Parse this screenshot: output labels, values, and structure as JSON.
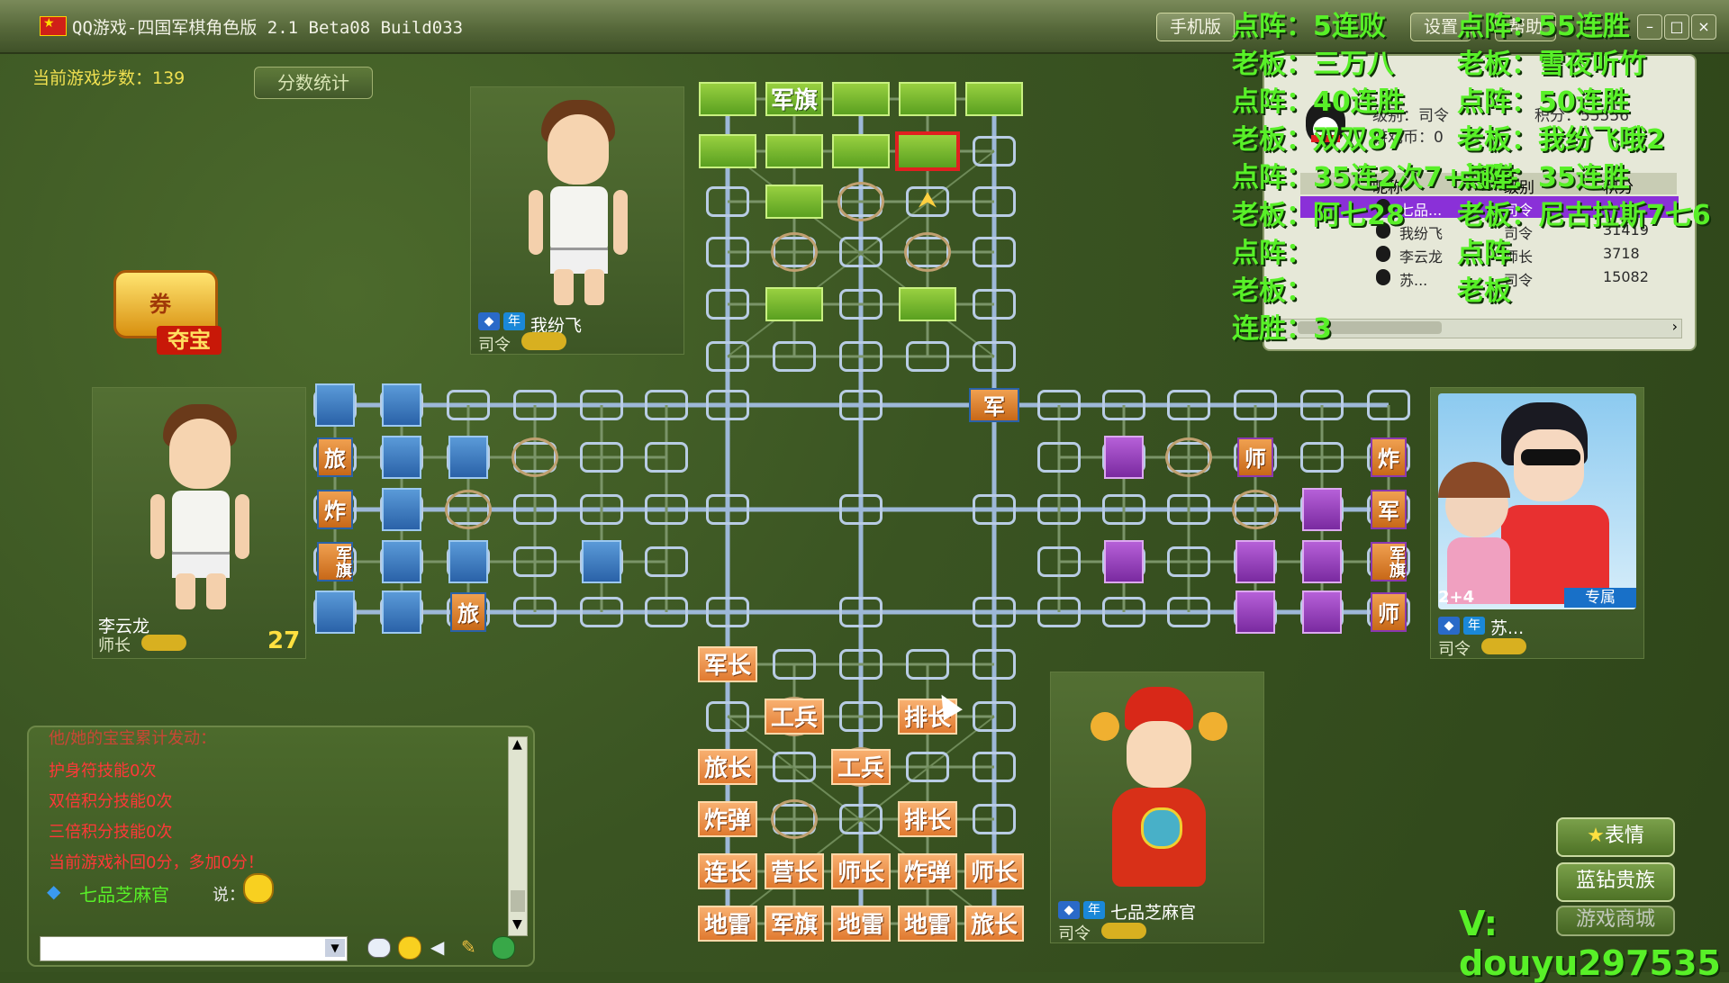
{
  "window": {
    "title": "QQ游戏-四国军棋角色版 2.1 Beta08 Build033",
    "buttons": [
      "手机版",
      "设置",
      "帮助"
    ],
    "controls": [
      "minimize",
      "maximize",
      "close"
    ]
  },
  "game": {
    "step_label": "当前游戏步数：139",
    "score_button": "分数统计",
    "treasure_label": "夺宝",
    "treasure_coupon": "券"
  },
  "players": {
    "top": {
      "name": "我纷飞",
      "rank": "司令"
    },
    "left": {
      "name": "李云龙",
      "rank": "师长",
      "timer": "27"
    },
    "right": {
      "name": "苏...",
      "rank": "司令",
      "exclusive": "专属",
      "level": "2+4"
    },
    "bottom": {
      "name": "七品芝麻官",
      "rank": "司令"
    }
  },
  "badges": {
    "vip": "年"
  },
  "overlay": {
    "left": [
      "点阵：5连败",
      "老板：三万八",
      "点阵：40连胜",
      "老板：双双87",
      "点阵：35连2次7+连胜",
      "老板：阿七28",
      "点阵：",
      "老板：",
      "连胜：3"
    ],
    "right": [
      "点阵：55连胜",
      "老板：雪夜听竹",
      "点阵：50连胜",
      "老板：我纷飞哦2",
      "点阵：35连胜",
      "老板：尼古拉斯7七6",
      "点阵",
      "老板"
    ]
  },
  "room": {
    "level_label": "级别：司令",
    "coins_label": "游戏币：0",
    "points_label": "积分：55556",
    "columns": [
      "昵称",
      "级别",
      "积分"
    ],
    "rows": [
      {
        "name": "七品...",
        "rank": "司令",
        "score": "",
        "selected": true
      },
      {
        "name": "我纷飞",
        "rank": "司令",
        "score": "31419",
        "selected": false
      },
      {
        "name": "李云龙",
        "rank": "师长",
        "score": "3718",
        "selected": false
      },
      {
        "name": "苏...",
        "rank": "司令",
        "score": "15082",
        "selected": false
      }
    ]
  },
  "chat": {
    "lines": [
      "他/她的宝宝累计发动：",
      "护身符技能0次",
      "双倍积分技能0次",
      "三倍积分技能0次",
      "当前游戏补回0分，多加0分！"
    ],
    "speaker": "七品芝麻官",
    "said": "说："
  },
  "side_buttons": [
    "表情",
    "蓝钻贵族",
    "游戏商城"
  ],
  "watermark": "V: douyu297535",
  "board": {
    "north_labels": {
      "junqi": "军旗"
    },
    "south_rows": [
      [
        "军长",
        "",
        "",
        "",
        ""
      ],
      [
        "",
        "工兵",
        "",
        "排长",
        ""
      ],
      [
        "旅长",
        "",
        "工兵",
        "",
        ""
      ],
      [
        "炸弹",
        "",
        "",
        "排长",
        ""
      ],
      [
        "连长",
        "营长",
        "师长",
        "炸弹",
        "师长"
      ],
      [
        "地雷",
        "军旗",
        "地雷",
        "地雷",
        "旅长"
      ]
    ],
    "west_labels": [
      "旅",
      "炸",
      "军旗",
      "旅"
    ],
    "east_labels": [
      "炸",
      "军",
      "军旗",
      "师",
      "师"
    ],
    "center_label": "军"
  },
  "colors": {
    "overlay": "#58f028",
    "north": "#5aa020",
    "south": "#e07a30",
    "west": "#2a62a8",
    "east": "#7a2aa0"
  }
}
